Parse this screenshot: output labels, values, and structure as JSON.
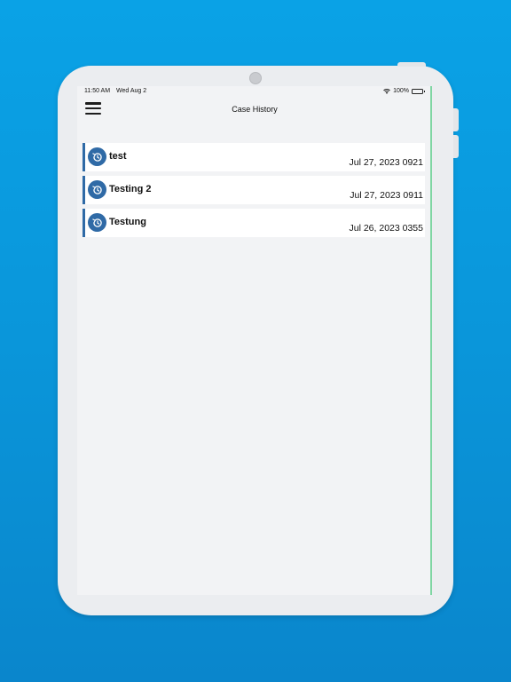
{
  "status_bar": {
    "time": "11:50 AM",
    "date": "Wed Aug 2",
    "battery": "100%"
  },
  "nav": {
    "title": "Case History",
    "menu_icon": "hamburger-menu-icon"
  },
  "cases": [
    {
      "title": "test",
      "date": "Jul 27, 2023 0921",
      "icon": "history-icon"
    },
    {
      "title": "Testing 2",
      "date": "Jul 27, 2023 0911",
      "icon": "history-icon"
    },
    {
      "title": "Testung",
      "date": "Jul 26, 2023 0355",
      "icon": "history-icon"
    }
  ],
  "colors": {
    "background": "#0a9ade",
    "accent": "#2f6aa6",
    "screen": "#f2f3f5"
  }
}
